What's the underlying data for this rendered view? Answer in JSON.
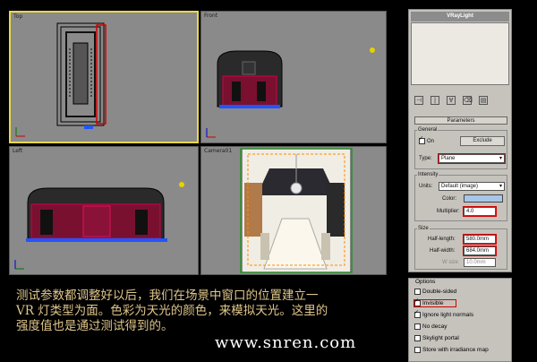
{
  "viewports": {
    "top": {
      "label": "Top"
    },
    "front": {
      "label": "Front"
    },
    "left": {
      "label": "Left"
    },
    "camera": {
      "label": "Camera01"
    }
  },
  "panel": {
    "object_name": "VRayLight",
    "rollout_title": "Parameters",
    "general": {
      "group_label": "General",
      "on_label": "On",
      "on_checked": true,
      "exclude_label": "Exclude",
      "type_label": "Type:",
      "type_value": "Plane"
    },
    "intensity": {
      "group_label": "Intensity",
      "units_label": "Units:",
      "units_value": "Default (image)",
      "color_label": "Color:",
      "color_value": "#a8c6e8",
      "multiplier_label": "Multiplier:",
      "multiplier_value": "4.0"
    },
    "size": {
      "group_label": "Size",
      "half_length_label": "Half-length:",
      "half_length_value": "580.0mm",
      "half_width_label": "Half-width:",
      "half_width_value": "684.0mm",
      "w_size_label": "W size",
      "w_size_value": "10.0mm"
    }
  },
  "options": {
    "group_label": "Options",
    "items": [
      {
        "label": "Double-sided",
        "checked": false
      },
      {
        "label": "Invisible",
        "checked": true
      },
      {
        "label": "Ignore light normals",
        "checked": true
      },
      {
        "label": "No decay",
        "checked": false
      },
      {
        "label": "Skylight portal",
        "checked": false
      },
      {
        "label": "Store with irradiance map",
        "checked": false
      }
    ]
  },
  "caption": {
    "line1": "测试参数都调整好以后，我们在场景中窗口的位置建立一",
    "line2": "VR 灯类型为面。色彩为天光的颜色，来模拟天光。这里的",
    "line3": "强度值也是通过测试得到的。"
  },
  "watermark": "www.snren.com",
  "colors": {
    "active_viewport": "#e8d84a",
    "highlight_red": "#d40000",
    "caption": "#e0c68a",
    "light_dot": "#e6d200"
  }
}
